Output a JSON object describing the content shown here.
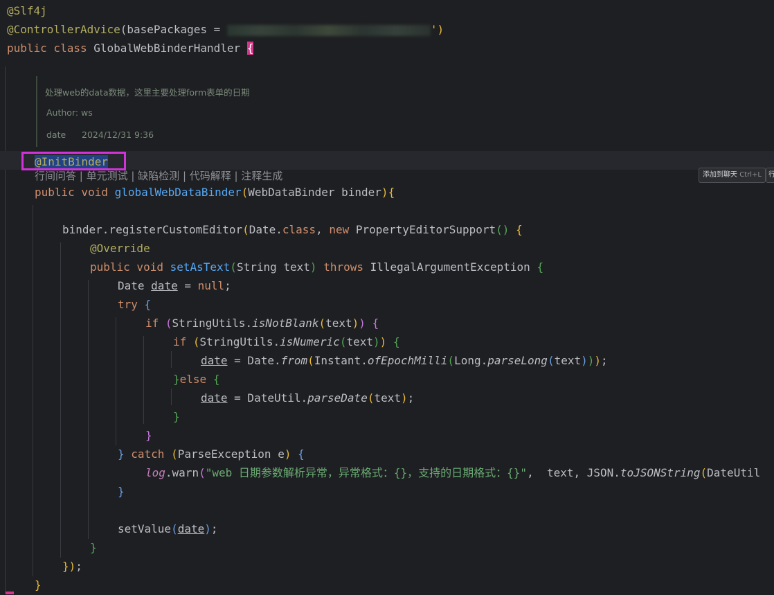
{
  "code": {
    "slf4j": "@Slf4j",
    "controller_advice": "@ControllerAdvice",
    "base_packages_open": "(basePackages = ",
    "base_packages_close": "')",
    "class_kw": "public class ",
    "class_name": "GlobalWebBinderHandler ",
    "class_brace": "{",
    "init_binder": "@InitBinder",
    "method_decl_public": "public void ",
    "method_name": "globalWebDataBinder",
    "method_params": "(WebDataBinder binder)",
    "method_brace": "{",
    "register_line_a": "binder.registerCustomEditor",
    "register_line_b": "(Date.",
    "register_line_c": "class",
    "register_line_d": ", ",
    "register_line_e": "new ",
    "register_line_f": "PropertyEditorSupport",
    "register_line_g": "() {",
    "override": "@Override",
    "setastext_kw": "public void ",
    "setastext_name": "setAsText",
    "setastext_params": "(String text) ",
    "setastext_throws": "throws ",
    "setastext_exc": "IllegalArgumentException ",
    "setastext_brace": "{",
    "date_decl_type": "Date ",
    "date_var": "date",
    "date_decl_rest": " = ",
    "null_kw": "null",
    "semi": ";",
    "try_kw": "try ",
    "open_brace": "{",
    "if_kw": "if ",
    "isnotblank_a": "(StringUtils.",
    "isnotblank_fn": "isNotBlank",
    "isnotblank_b": "(text)",
    "isnotblank_c": ") {",
    "isnumeric_fn": "isNumeric",
    "assign_eq": " = Date.",
    "from_fn": "from",
    "instant_a": "(Instant.",
    "epoch_fn": "ofEpochMilli",
    "long_a": "(Long.",
    "parselong_fn": "parseLong",
    "text_arg": "(text)",
    "close_parens": "));",
    "else_a": "}",
    "else_kw": "else ",
    "dateutil_a": " = DateUtil.",
    "parsedate_fn": "parseDate",
    "close_brace": "}",
    "catch_close": "} ",
    "catch_kw": "catch ",
    "catch_params": "(ParseException e) ",
    "log_var": "log",
    "log_warn": ".warn(",
    "log_str": "\"web 日期参数解析异常，异常格式：{}，支持的日期格式：{}\"",
    "log_rest_a": ",  text, JSON.",
    "tojson_fn": "toJSONString",
    "log_rest_b": "(DateUtil",
    "setvalue_a": "setValue(",
    "setvalue_b": ");",
    "anon_close": "});",
    "method_close": "}"
  },
  "doc_comment": {
    "description": "处理web的data数据，这里主要处理form表单的日期",
    "author": "Author: ws",
    "date_label": "date",
    "date_value": "2024/12/31 9:36"
  },
  "codelens": {
    "text": "行间问答 | 单元测试 | 缺陷检测 | 代码解释 | 注释生成"
  },
  "chat_chip": {
    "label": "添加到聊天",
    "shortcut": "Ctrl+L",
    "second_label": "行"
  },
  "colors": {
    "background": "#1e1f22",
    "annotation": "#b3ae60",
    "keyword": "#cf8e6d",
    "method": "#56a8f5",
    "string": "#6aab73",
    "highlight_box": "#d233d8",
    "brace_highlight": "#d6358c"
  }
}
